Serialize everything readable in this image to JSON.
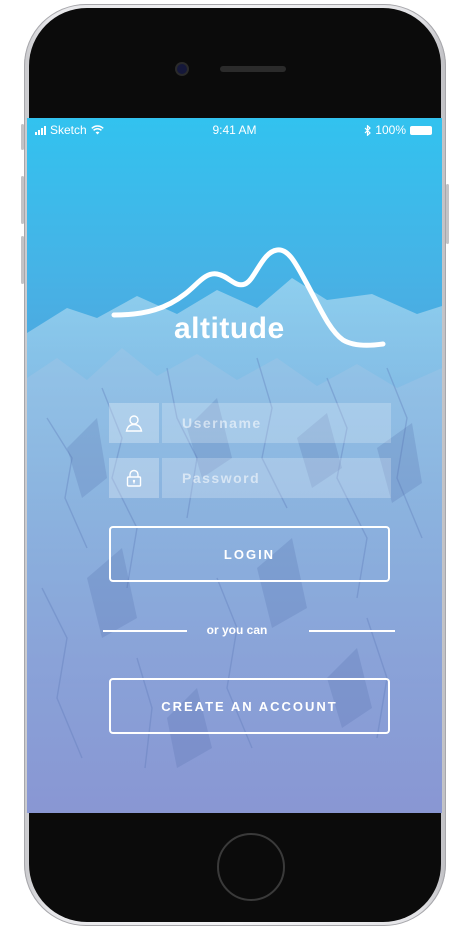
{
  "status_bar": {
    "carrier": "Sketch",
    "time": "9:41 AM",
    "battery": "100%"
  },
  "logo": {
    "text": "altitude"
  },
  "login_form": {
    "username_placeholder": "Username",
    "password_placeholder": "Password",
    "login_label": "LOGIN"
  },
  "divider": {
    "text": "or you can"
  },
  "signup": {
    "create_account_label": "CREATE AN ACCOUNT"
  },
  "colors": {
    "gradient_top": "#32c2ef",
    "gradient_bottom": "#7474c6",
    "foreground": "#ffffff"
  }
}
